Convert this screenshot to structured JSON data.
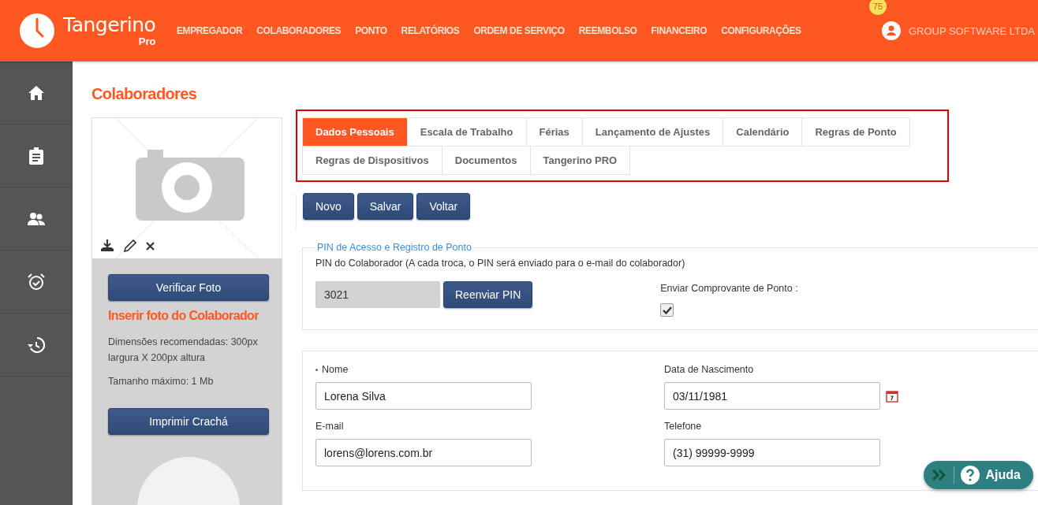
{
  "header": {
    "logo_text": "Tangerino",
    "logo_sub": "Pro",
    "nav": [
      "EMPREGADOR",
      "COLABORADORES",
      "PONTO",
      "RELATÓRIOS",
      "ORDEM DE SERVIÇO",
      "REEMBOLSO",
      "FINANCEIRO",
      "CONFIGURAÇÕES"
    ],
    "notification_count": "75",
    "user": "GROUP SOFTWARE LTDA"
  },
  "sidebar": {
    "items": [
      {
        "kind": "home",
        "selected": false
      },
      {
        "kind": "clipboard",
        "selected": false
      },
      {
        "kind": "people",
        "selected": false
      },
      {
        "kind": "alarm",
        "selected": false
      },
      {
        "kind": "history",
        "selected": false
      }
    ]
  },
  "page_title": "Colaboradores",
  "photo_panel": {
    "verify_button": "Verificar Foto",
    "heading": "Inserir foto do Colaborador",
    "notes": [
      "Dimensões recomendadas: 300px largura X 200px altura",
      "Tamanho máximo: 1 Mb"
    ],
    "print_button": "Imprimir Crachá"
  },
  "tabs": [
    [
      {
        "label": "Dados Pessoais",
        "selected": true
      },
      {
        "label": "Escala de Trabalho",
        "selected": false
      },
      {
        "label": "Férias",
        "selected": false
      },
      {
        "label": "Lançamento de Ajustes",
        "selected": false
      },
      {
        "label": "Calendário",
        "selected": false
      },
      {
        "label": "Regras de Ponto",
        "selected": false
      }
    ],
    [
      {
        "label": "Regras de Dispositivos",
        "selected": false
      },
      {
        "label": "Documentos",
        "selected": false
      },
      {
        "label": "Tangerino PRO",
        "selected": false
      }
    ]
  ],
  "action_buttons": [
    "Novo",
    "Salvar",
    "Voltar"
  ],
  "pin_section": {
    "legend": "PIN de Acesso e Registro de Ponto",
    "label": "PIN do Colaborador (A cada troca, o PIN será enviado para o e-mail do colaborador)",
    "pin_value": "3021",
    "resend_button": "Reenviar PIN",
    "receipt_label": "Enviar Comprovante de Ponto :",
    "receipt_checked": true
  },
  "personal_fields": [
    {
      "label": "Nome",
      "value": "Lorena Silva",
      "required": true,
      "calendar": false
    },
    {
      "label": "Data de Nascimento",
      "value": "03/11/1981",
      "required": false,
      "calendar": true
    },
    {
      "label": "E-mail",
      "value": "lorens@lorens.com.br",
      "required": false,
      "calendar": false
    },
    {
      "label": "Telefone",
      "value": "(31) 99999-9999",
      "required": false,
      "calendar": false
    }
  ],
  "help_button": "Ajuda"
}
